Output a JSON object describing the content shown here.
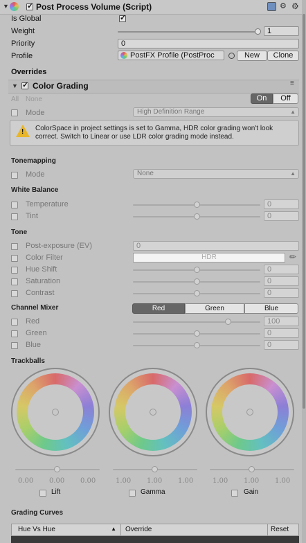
{
  "header": {
    "title": "Post Process Volume (Script)"
  },
  "volume": {
    "is_global_label": "Is Global",
    "weight_label": "Weight",
    "weight_value": "1",
    "weight_fraction": 1.0,
    "priority_label": "Priority",
    "priority_value": "0",
    "profile_label": "Profile",
    "profile_value": "PostFX Profile (PostProc",
    "new_button": "New",
    "clone_button": "Clone"
  },
  "overrides": {
    "title": "Overrides",
    "effect_title": "Color Grading",
    "all_label": "All",
    "none_label": "None",
    "on_label": "On",
    "off_label": "Off",
    "mode_label": "Mode",
    "mode_value": "High Definition Range",
    "warning_text": "ColorSpace in project settings is set to Gamma, HDR color grading won't look correct. Switch to Linear or use LDR color grading mode instead."
  },
  "tonemapping": {
    "title": "Tonemapping",
    "mode_label": "Mode",
    "mode_value": "None"
  },
  "white_balance": {
    "title": "White Balance",
    "temperature_label": "Temperature",
    "temperature_value": "0",
    "tint_label": "Tint",
    "tint_value": "0"
  },
  "tone": {
    "title": "Tone",
    "post_exposure_label": "Post-exposure (EV)",
    "post_exposure_value": "0",
    "color_filter_label": "Color Filter",
    "color_filter_value": "HDR",
    "hue_shift_label": "Hue Shift",
    "hue_shift_value": "0",
    "saturation_label": "Saturation",
    "saturation_value": "0",
    "contrast_label": "Contrast",
    "contrast_value": "0"
  },
  "channel_mixer": {
    "title": "Channel Mixer",
    "tabs": [
      "Red",
      "Green",
      "Blue"
    ],
    "red_label": "Red",
    "red_value": "100",
    "green_label": "Green",
    "green_value": "0",
    "blue_label": "Blue",
    "blue_value": "0"
  },
  "trackballs": {
    "title": "Trackballs",
    "lift_label": "Lift",
    "gamma_label": "Gamma",
    "gain_label": "Gain",
    "lift_values": [
      "0.00",
      "0.00",
      "0.00"
    ],
    "gamma_values": [
      "1.00",
      "1.00",
      "1.00"
    ],
    "gain_values": [
      "1.00",
      "1.00",
      "1.00"
    ]
  },
  "grading_curves": {
    "title": "Grading Curves",
    "curve_select": "Hue Vs Hue",
    "override_label": "Override",
    "reset_label": "Reset"
  }
}
